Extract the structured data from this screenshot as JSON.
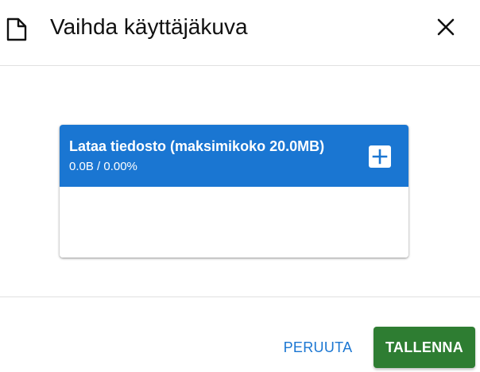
{
  "dialog": {
    "title": "Vaihda käyttäjäkuva",
    "title_icon": "document-icon",
    "close_icon": "close-icon"
  },
  "upload": {
    "title": "Lataa tiedosto (maksimikoko 20.0MB)",
    "progress": "0.0B / 0.00%",
    "add_icon": "plus-icon",
    "header_color": "#1a76d2"
  },
  "footer": {
    "cancel_label": "PERUUTA",
    "save_label": "TALLENNA",
    "cancel_color": "#1a76d2",
    "save_color": "#2e7d32"
  }
}
